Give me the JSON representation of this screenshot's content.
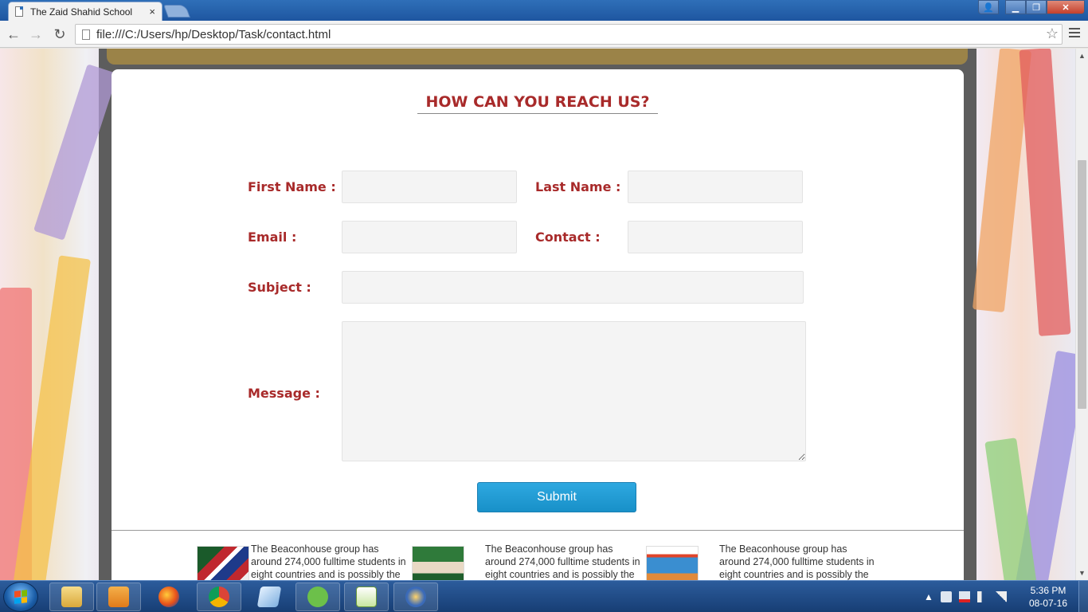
{
  "browser": {
    "tab_title": "The Zaid Shahid School",
    "tab_close": "×",
    "url": "file:///C:/Users/hp/Desktop/Task/contact.html",
    "back_glyph": "←",
    "forward_glyph": "→",
    "reload_glyph": "↻",
    "star_glyph": "☆"
  },
  "window_controls": {
    "user": "👤",
    "minimize": "▁",
    "maximize": "❐",
    "close": "✕"
  },
  "page": {
    "heading": "HOW CAN YOU REACH US?",
    "form": {
      "first_name_label": "First Name :",
      "last_name_label": "Last Name :",
      "email_label": "Email :",
      "contact_label": "Contact :",
      "subject_label": "Subject :",
      "message_label": "Message :",
      "first_name_value": "",
      "last_name_value": "",
      "email_value": "",
      "contact_value": "",
      "subject_value": "",
      "message_value": "",
      "submit_label": "Submit"
    },
    "news": [
      {
        "text": "The Beaconhouse group has around 274,000 fulltime students in eight countries and is possibly the largest"
      },
      {
        "text": "The Beaconhouse group has around 274,000 fulltime students in eight countries and is possibly the largest"
      },
      {
        "text": "The Beaconhouse group has around 274,000 fulltime students in eight countries and is possibly the largest"
      }
    ]
  },
  "scrollbar": {
    "up_glyph": "▲",
    "down_glyph": "▼"
  },
  "taskbar": {
    "apps": [
      "file-explorer",
      "media-player",
      "firefox",
      "chrome",
      "notepad",
      "utorrent",
      "notepad-plus-plus",
      "media-center"
    ],
    "tray_arrow": "▲",
    "time": "5:36 PM",
    "date": "08-07-16"
  },
  "colors": {
    "accent_red": "#a82a2a",
    "submit_blue": "#1890c8",
    "gold_bar": "#9b8348",
    "taskbar": "#1e4a86"
  }
}
